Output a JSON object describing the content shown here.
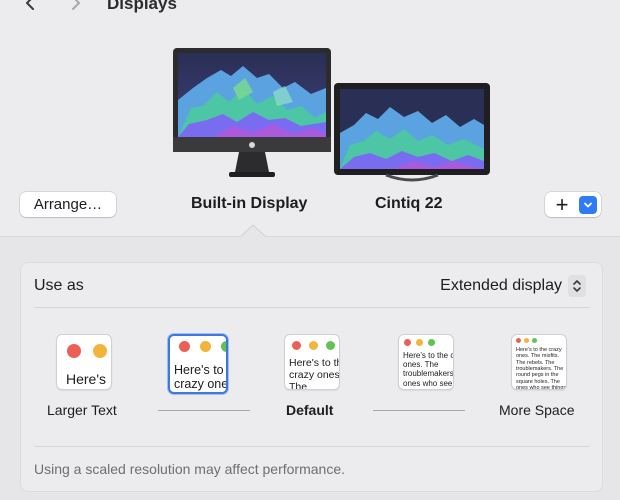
{
  "header": {
    "title": "Displays",
    "back_icon": "chevron-left-icon",
    "forward_icon": "chevron-right-icon"
  },
  "arrangement": {
    "arrange_label": "Arrange…",
    "displays": [
      {
        "name": "Built-in Display",
        "selected": true
      },
      {
        "name": "Cintiq 22",
        "selected": false
      }
    ],
    "add_label": "+",
    "add_icon": "chevron-down-icon"
  },
  "settings": {
    "use_as_label": "Use as",
    "use_as_value": "Extended display",
    "resolution_options": [
      {
        "label": "Larger Text",
        "preview": "Here's",
        "selected": false
      },
      {
        "label": "",
        "preview": "Here's to the crazy ones, the troublemakers",
        "selected": true
      },
      {
        "label": "Default",
        "preview": "Here's to the crazy ones. The troublemakers. The ones who see things",
        "selected": false
      },
      {
        "label": "",
        "preview": "Here's to the crazy ones. The troublemakers. The ones who see things differently. They're not fond of rules. And they have",
        "selected": false
      },
      {
        "label": "More Space",
        "preview": "Here's to the crazy ones. The misfits. The rebels. The troublemakers. The round pegs in the square holes. The ones who see things differently. They're not fond of rules. And they have no respect for the status quo. You can quote them, disagree with them. About the only thing you can't do is ignore them. Because they change things.",
        "selected": false
      }
    ],
    "footer_note": "Using a scaled resolution may affect performance."
  },
  "colors": {
    "accent": "#2f7cf6",
    "dot_red": "#ec5f57",
    "dot_yellow": "#f2b43a",
    "dot_green": "#5fc453"
  }
}
